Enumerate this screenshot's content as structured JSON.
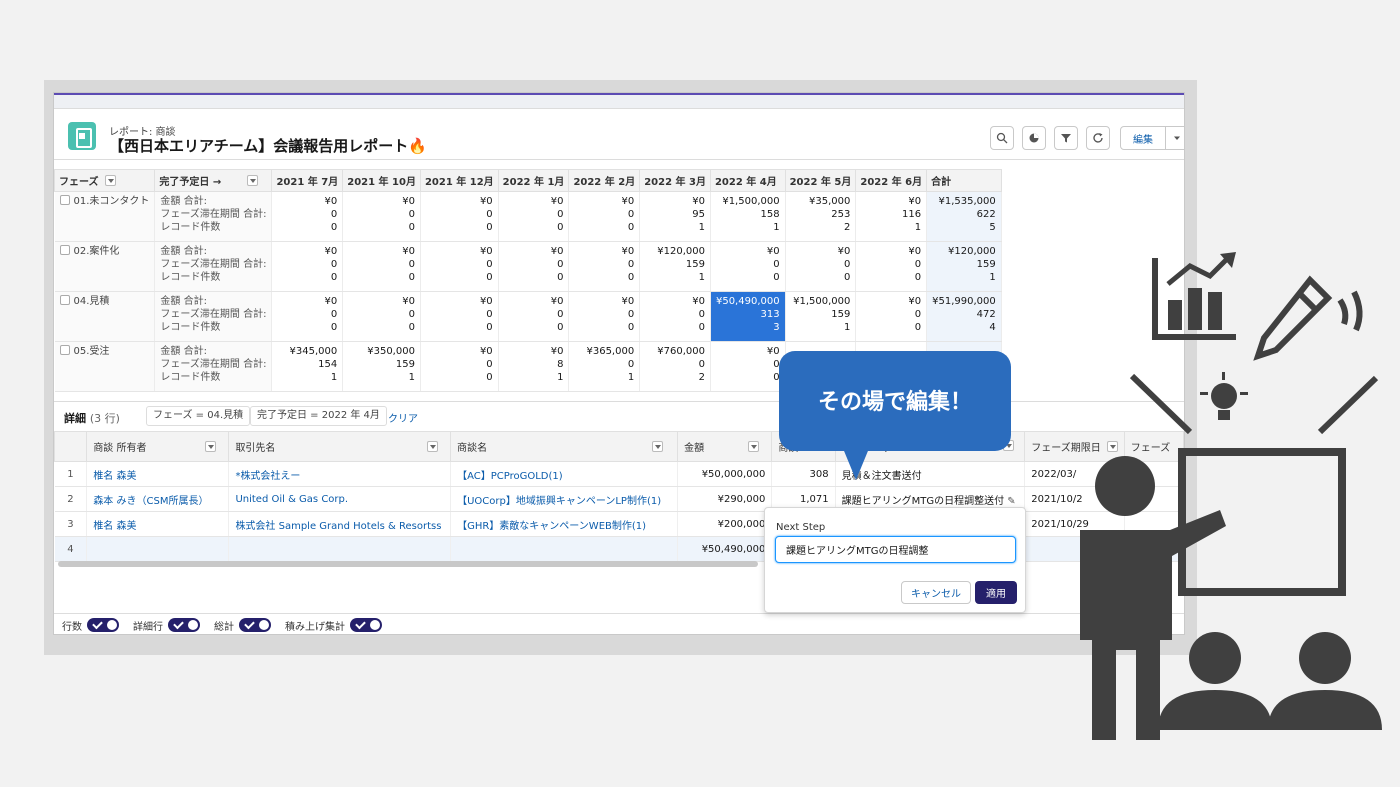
{
  "header": {
    "subtitle": "レポート: 商談",
    "title": "【西日本エリアチーム】会議報告用レポート🔥",
    "edit_label": "編集"
  },
  "summary": {
    "phase_header": "フェーズ",
    "date_header": "完了予定日 →",
    "months": [
      "2021 年 7月",
      "2021 年 10月",
      "2021 年 12月",
      "2022 年 1月",
      "2022 年 2月",
      "2022 年 3月",
      "2022 年 4月",
      "2022 年 5月",
      "2022 年 6月"
    ],
    "total_header": "合計",
    "metric_labels": [
      "金額 合計:",
      "フェーズ滞在期間 合計:",
      "レコード件数"
    ],
    "rows": [
      {
        "phase": "01.未コンタクト",
        "cells": [
          [
            "¥0",
            "0",
            "0"
          ],
          [
            "¥0",
            "0",
            "0"
          ],
          [
            "¥0",
            "0",
            "0"
          ],
          [
            "¥0",
            "0",
            "0"
          ],
          [
            "¥0",
            "0",
            "0"
          ],
          [
            "¥0",
            "95",
            "1"
          ],
          [
            "¥1,500,000",
            "158",
            "1"
          ],
          [
            "¥35,000",
            "253",
            "2"
          ],
          [
            "¥0",
            "116",
            "1"
          ]
        ],
        "total": [
          "¥1,535,000",
          "622",
          "5"
        ]
      },
      {
        "phase": "02.案件化",
        "cells": [
          [
            "¥0",
            "0",
            "0"
          ],
          [
            "¥0",
            "0",
            "0"
          ],
          [
            "¥0",
            "0",
            "0"
          ],
          [
            "¥0",
            "0",
            "0"
          ],
          [
            "¥0",
            "0",
            "0"
          ],
          [
            "¥120,000",
            "159",
            "1"
          ],
          [
            "¥0",
            "0",
            "0"
          ],
          [
            "¥0",
            "0",
            "0"
          ],
          [
            "¥0",
            "0",
            "0"
          ]
        ],
        "total": [
          "¥120,000",
          "159",
          "1"
        ]
      },
      {
        "phase": "04.見積",
        "cells": [
          [
            "¥0",
            "0",
            "0"
          ],
          [
            "¥0",
            "0",
            "0"
          ],
          [
            "¥0",
            "0",
            "0"
          ],
          [
            "¥0",
            "0",
            "0"
          ],
          [
            "¥0",
            "0",
            "0"
          ],
          [
            "¥0",
            "0",
            "0"
          ],
          [
            "¥50,490,000",
            "313",
            "3"
          ],
          [
            "¥1,500,000",
            "159",
            "1"
          ],
          [
            "¥0",
            "0",
            "0"
          ]
        ],
        "total": [
          "¥51,990,000",
          "472",
          "4"
        ]
      },
      {
        "phase": "05.受注",
        "cells": [
          [
            "¥345,000",
            "154",
            "1"
          ],
          [
            "¥350,000",
            "159",
            "1"
          ],
          [
            "¥0",
            "0",
            "0"
          ],
          [
            "¥0",
            "8",
            "1"
          ],
          [
            "¥365,000",
            "0",
            "1"
          ],
          [
            "¥760,000",
            "0",
            "2"
          ],
          [
            "¥0",
            "0",
            "0"
          ],
          [
            "",
            "",
            " "
          ],
          [
            "",
            "",
            ""
          ]
        ],
        "total": [
          "",
          "",
          ""
        ]
      }
    ]
  },
  "detail": {
    "title": "詳細",
    "count": "(3 行)",
    "filter_phase": "フェーズ = 04.見積",
    "filter_date": "完了予定日 = 2022 年 4月",
    "clear": "クリア",
    "headers": [
      "商談 所有者",
      "取引先名",
      "商談名",
      "金額",
      "商談",
      "Next Step",
      "フェーズ期限日",
      "フェーズ"
    ],
    "rows": [
      [
        "1",
        "椎名 森美",
        "*株式会社えー",
        "【AC】PCProGOLD(1)",
        "¥50,000,000",
        "308",
        "見積＆注文書送付",
        "2022/03/"
      ],
      [
        "2",
        "森本 みき（CSM所属長）",
        "United Oil & Gas Corp.",
        "【UOCorp】地域振興キャンペーンLP制作(1)",
        "¥290,000",
        "1,071",
        "課題ヒアリングMTGの日程調整送付",
        "2021/10/2"
      ],
      [
        "3",
        "椎名 森美",
        "株式会社 Sample Grand Hotels & Resortss",
        "【GHR】素敵なキャンペーンWEB制作(1)",
        "¥200,000",
        "",
        "",
        "2021/10/29"
      ],
      [
        "4",
        "",
        "",
        "",
        "¥50,490,000",
        "",
        "",
        ""
      ]
    ]
  },
  "footer": {
    "toggles": [
      "行数",
      "詳細行",
      "総計",
      "積み上げ集計"
    ]
  },
  "popover": {
    "label": "Next Step",
    "value": "課題ヒアリングMTGの日程調整",
    "cancel": "キャンセル",
    "apply": "適用"
  },
  "bubble": {
    "text": "その場で編集！"
  },
  "colors": {
    "accent": "#25206b",
    "bubble": "#2b6cbd",
    "selected_cell": "#2a74d8",
    "illustration": "#404040"
  }
}
